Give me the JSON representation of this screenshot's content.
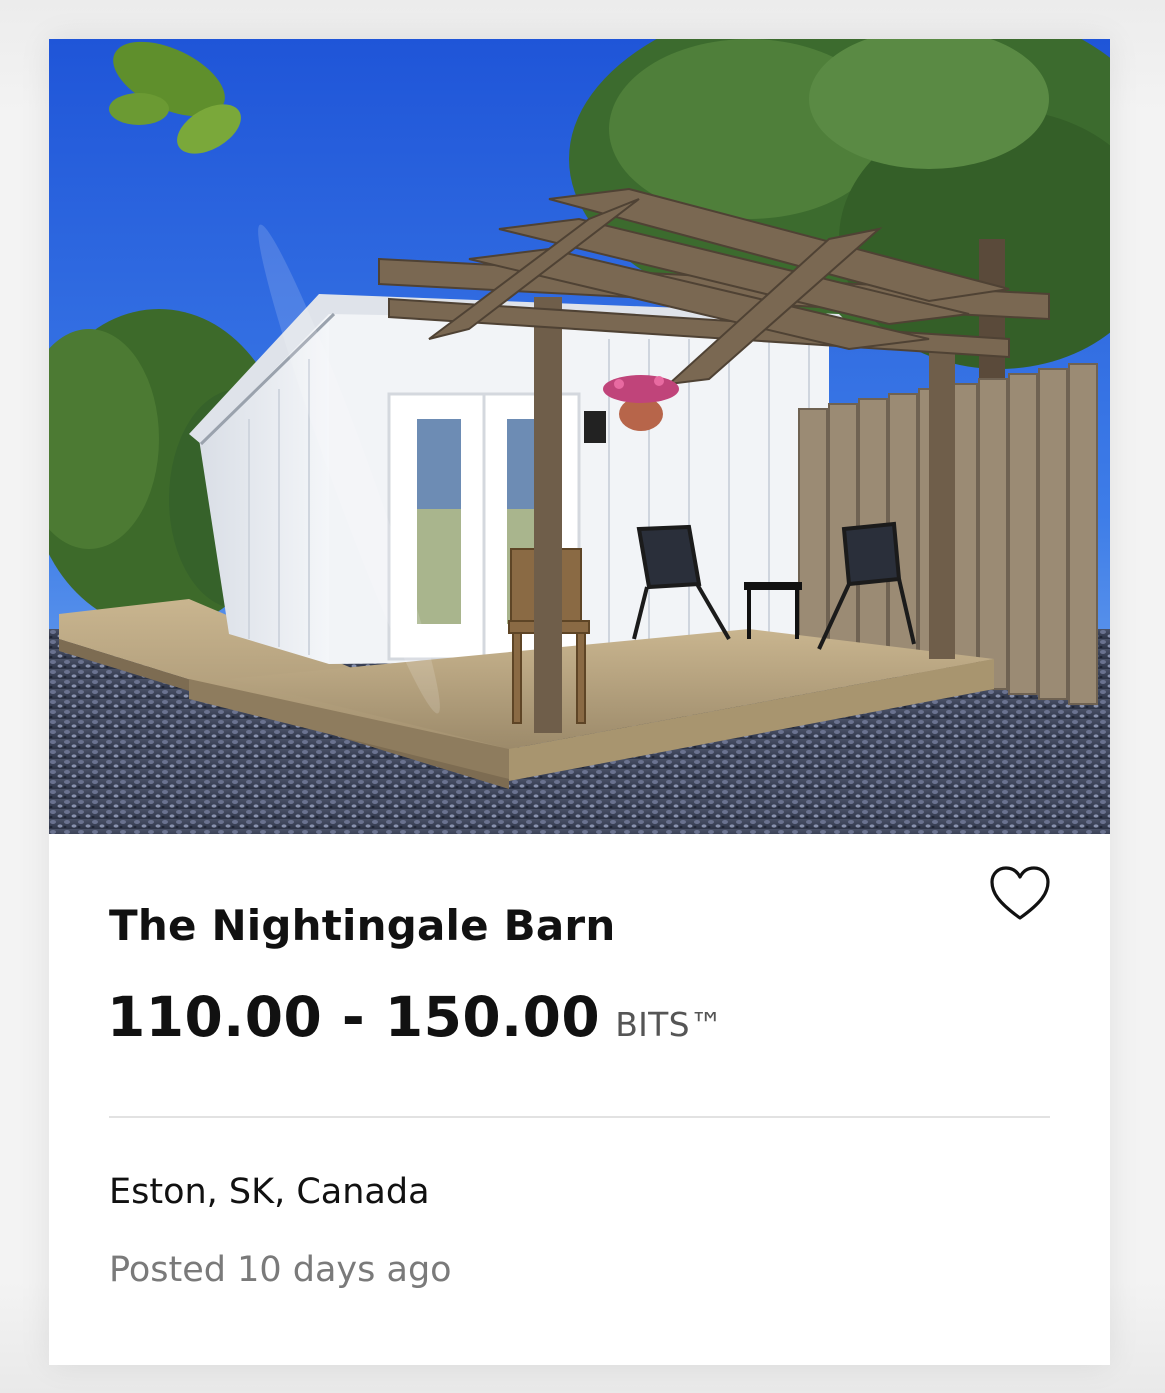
{
  "listing": {
    "photo_alt": "The Nightingale Barn",
    "title": "The Nightingale Barn",
    "price_range": "110.00 - 150.00",
    "price_unit": "BITS™",
    "location": "Eston, SK, Canada",
    "posted": "Posted 10 days ago",
    "favorite_icon": "heart-outline-icon"
  },
  "colors": {
    "title": "#111111",
    "muted": "#7a7a7a",
    "unit": "#555555",
    "divider": "#e2e2e2",
    "card_background": "#ffffff"
  }
}
